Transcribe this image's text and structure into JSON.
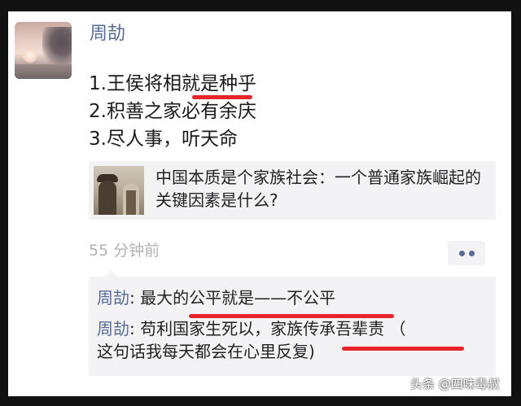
{
  "post": {
    "author": "周劼",
    "lines": [
      "1.王侯将相就是种乎",
      "2.积善之家必有余庆",
      "3.尽人事，听天命"
    ],
    "link_title": "中国本质是个家族社会：一个普通家族崛起的关键因素是什么?",
    "time": "55 分钟前"
  },
  "comments": [
    {
      "author": "周劼",
      "sep": ": ",
      "text": "最大的公平就是——不公平"
    },
    {
      "author": "周劼",
      "sep": ": ",
      "text": "苟利国家生死以，家族传承吾辈责 （",
      "text2": "这句话我每天都会在心里反复)"
    }
  ],
  "watermark": "头条 @四味毒叔",
  "colors": {
    "name_link": "#576b95",
    "underline": "#e8242a",
    "bubble_bg": "#f3f3f5",
    "time": "#b2b2b2"
  }
}
